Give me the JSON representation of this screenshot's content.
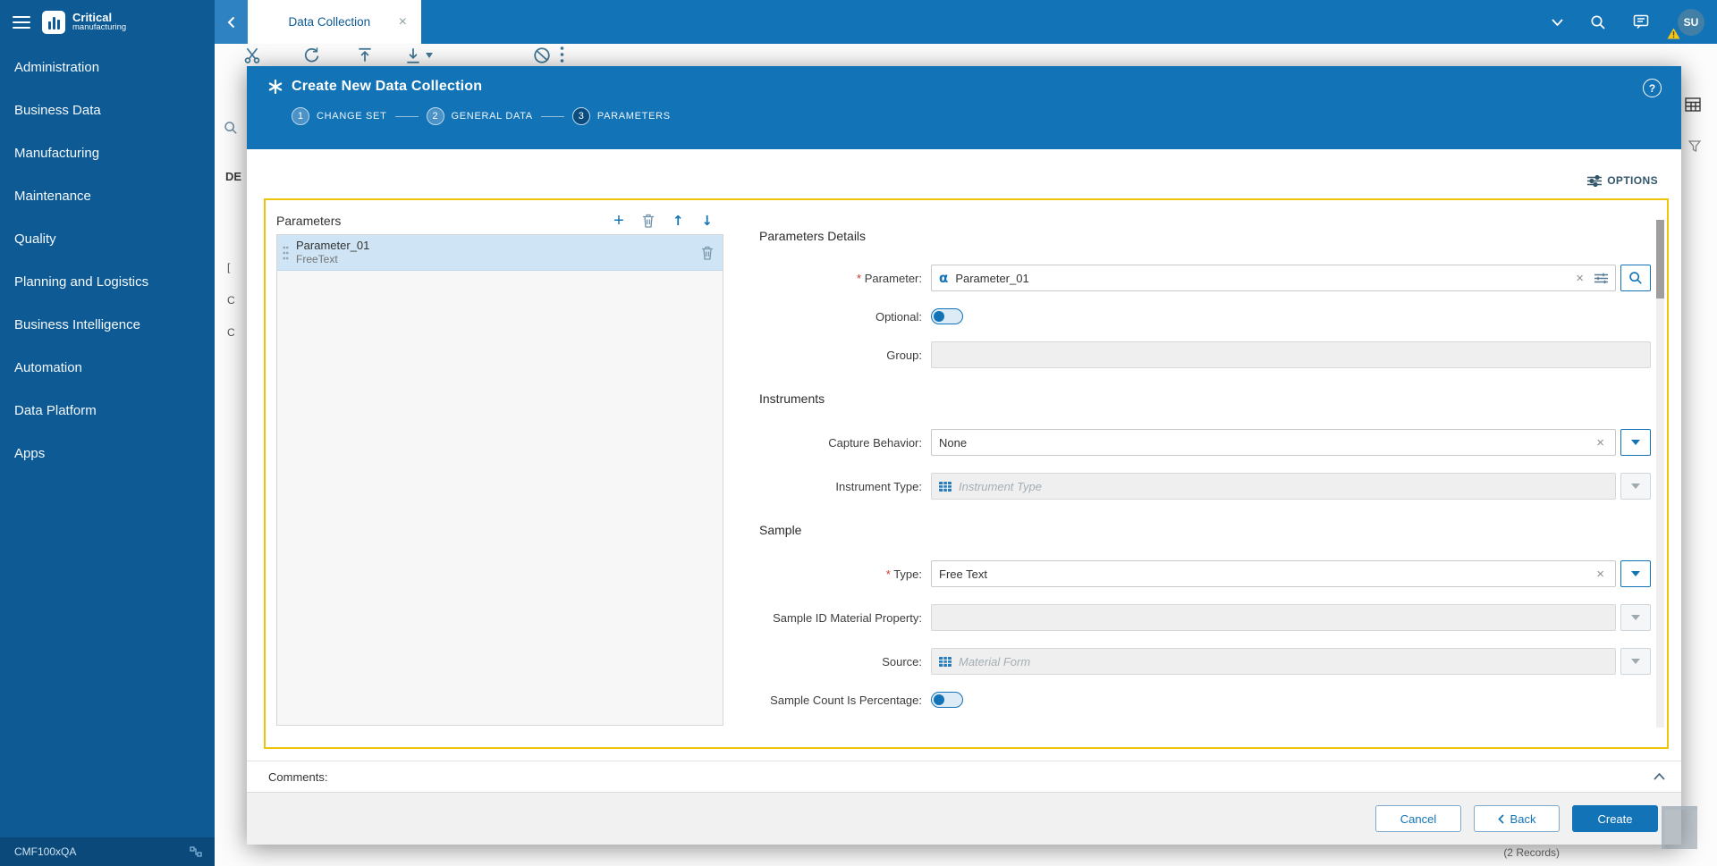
{
  "colors": {
    "primary_blue": "#1373b7",
    "sidebar_blue": "#0d5a95",
    "accent_yellow": "#edc30b",
    "selected_row_blue": "#cfe4f4"
  },
  "sidebar": {
    "logo_title": "Critical",
    "logo_subtitle": "manufacturing",
    "items": [
      "Administration",
      "Business Data",
      "Manufacturing",
      "Maintenance",
      "Quality",
      "Planning and Logistics",
      "Business Intelligence",
      "Automation",
      "Data Platform",
      "Apps"
    ],
    "footer_label": "CMF100xQA"
  },
  "topbar": {
    "tab_label": "Data Collection",
    "avatar_text": "SU"
  },
  "background": {
    "fragments": [
      "DE",
      "[",
      "C",
      "C"
    ],
    "records_label": "(2 Records)"
  },
  "modal": {
    "title": "Create New Data Collection",
    "help_glyph": "?",
    "steps": [
      {
        "num": "1",
        "label": "CHANGE SET"
      },
      {
        "num": "2",
        "label": "GENERAL DATA"
      },
      {
        "num": "3",
        "label": "PARAMETERS"
      }
    ],
    "options_label": "OPTIONS",
    "parameters_panel": {
      "title": "Parameters",
      "items": [
        {
          "name": "Parameter_01",
          "type": "FreeText"
        }
      ]
    },
    "details": {
      "title": "Parameters Details",
      "sections": {
        "instruments": "Instruments",
        "sample": "Sample"
      },
      "fields": {
        "parameter": {
          "label": "Parameter:",
          "value": "Parameter_01"
        },
        "optional": {
          "label": "Optional:",
          "state": "off"
        },
        "group": {
          "label": "Group:",
          "value": ""
        },
        "capture_behavior": {
          "label": "Capture Behavior:",
          "value": "None"
        },
        "instrument_type": {
          "label": "Instrument Type:",
          "placeholder": "Instrument Type"
        },
        "type": {
          "label": "Type:",
          "value": "Free Text"
        },
        "sample_id_material_property": {
          "label": "Sample ID Material Property:",
          "value": ""
        },
        "source": {
          "label": "Source:",
          "placeholder": "Material Form"
        },
        "sample_count_is_percentage": {
          "label": "Sample Count Is Percentage:",
          "state": "off"
        }
      }
    },
    "comments_label": "Comments:",
    "footer": {
      "cancel_label": "Cancel",
      "back_label": "Back",
      "create_label": "Create"
    }
  }
}
